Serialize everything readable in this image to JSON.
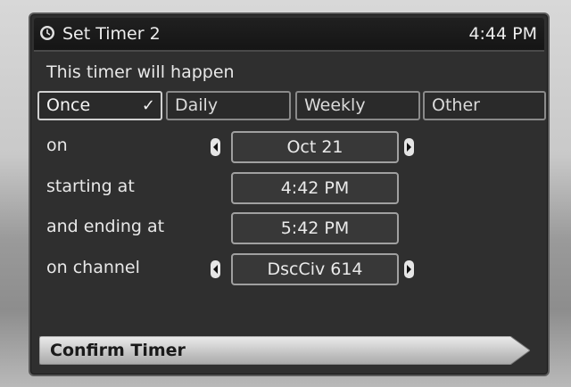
{
  "header": {
    "title": "Set Timer 2",
    "clock": "4:44 PM",
    "icon": "clock-icon"
  },
  "intro": "This timer will happen",
  "frequency": {
    "options": [
      "Once",
      "Daily",
      "Weekly",
      "Other"
    ],
    "selected": "Once",
    "check_mark": "✓"
  },
  "fields": {
    "date": {
      "label": "on",
      "value": "Oct 21"
    },
    "start": {
      "label": "starting at",
      "value": "4:42 PM"
    },
    "end": {
      "label": "and ending at",
      "value": "5:42 PM"
    },
    "channel": {
      "label": "on channel",
      "value": "DscCiv 614"
    }
  },
  "confirm_label": "Confirm Timer"
}
